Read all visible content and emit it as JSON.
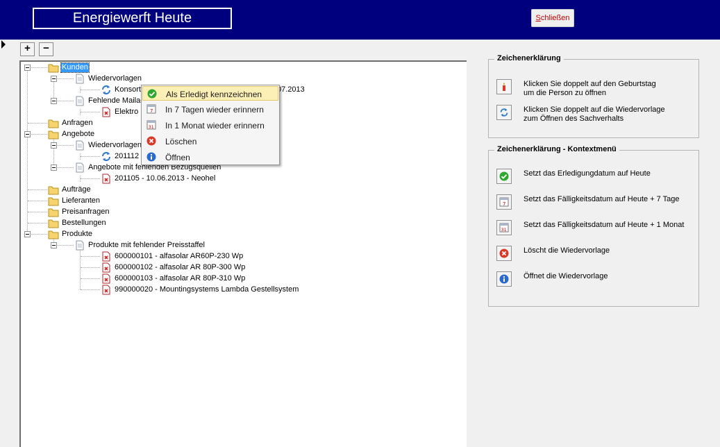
{
  "header": {
    "title": "Energiewerft Heute",
    "close_label_first": "S",
    "close_label_rest": "chließen"
  },
  "toolbar": {
    "expand_all_label": "+",
    "collapse_all_label": "−"
  },
  "tree": {
    "root_kunden": "Kunden",
    "wiedervorlagen_1": "Wiedervorlagen",
    "konsort": "Konsort",
    "konsort_tail": "07.2013",
    "fehlende_mailad": "Fehlende Mailad",
    "elektro": "Elektro B",
    "anfragen": "Anfragen",
    "angebote": "Angebote",
    "wiedervorlagen_2": "Wiedervorlagen",
    "item_201112": "201112",
    "angebote_fehlende": "Angebote mit fehlenden Bezugsquellen",
    "item_201105": "201105 - 10.06.2013 - Neohel",
    "auftraege": "Aufträge",
    "lieferanten": "Lieferanten",
    "preisanfragen": "Preisanfragen",
    "bestellungen": "Bestellungen",
    "produkte": "Produkte",
    "produkte_fehlende": "Produkte mit fehlender Preisstaffel",
    "p1": "600000101 - alfasolar AR60P-230 Wp",
    "p2": "600000102 - alfasolar AR 80P-300 Wp",
    "p3": "600000103 - alfasolar AR 80P-310 Wp",
    "p4": "990000020 - Mountingsystems Lambda Gestellsystem"
  },
  "context_menu": {
    "items": [
      {
        "label": "Als Erledigt kennzeichnen",
        "icon": "check-icon"
      },
      {
        "label": "In 7 Tagen wieder erinnern",
        "icon": "calendar-7-icon"
      },
      {
        "label": "In 1 Monat wieder erinnern",
        "icon": "calendar-31-icon"
      },
      {
        "label": "Löschen",
        "icon": "delete-icon"
      },
      {
        "label": "Öffnen",
        "icon": "info-icon"
      }
    ]
  },
  "legend": {
    "title": "Zeichenerklärung",
    "items": [
      {
        "line1": "Klicken Sie doppelt auf den Geburtstag",
        "line2": "um die Person zu öffnen",
        "icon": "birthday-candle-icon"
      },
      {
        "line1": "Klicken Sie doppelt auf die Wiedervorlage",
        "line2": "zum Öffnen des Sachverhalts",
        "icon": "refresh-icon"
      }
    ]
  },
  "legend_context": {
    "title": "Zeichenerklärung - Kontextmenü",
    "items": [
      {
        "text": "Setzt das Erledigungdatum auf Heute",
        "icon": "check-icon"
      },
      {
        "text": "Setzt das Fälligkeitsdatum auf Heute + 7 Tage",
        "icon": "calendar-7-icon"
      },
      {
        "text": "Setzt das Fälligkeitsdatum auf Heute + 1 Monat",
        "icon": "calendar-31-icon"
      },
      {
        "text": "Löscht die Wiedervorlage",
        "icon": "delete-icon"
      },
      {
        "text": "Öffnet die Wiedervorlage",
        "icon": "info-icon"
      }
    ]
  },
  "colors": {
    "header_bg": "#00007f",
    "selection": "#3399ff",
    "menu_hover": "#fdf0b6",
    "close_text": "#c00000"
  }
}
